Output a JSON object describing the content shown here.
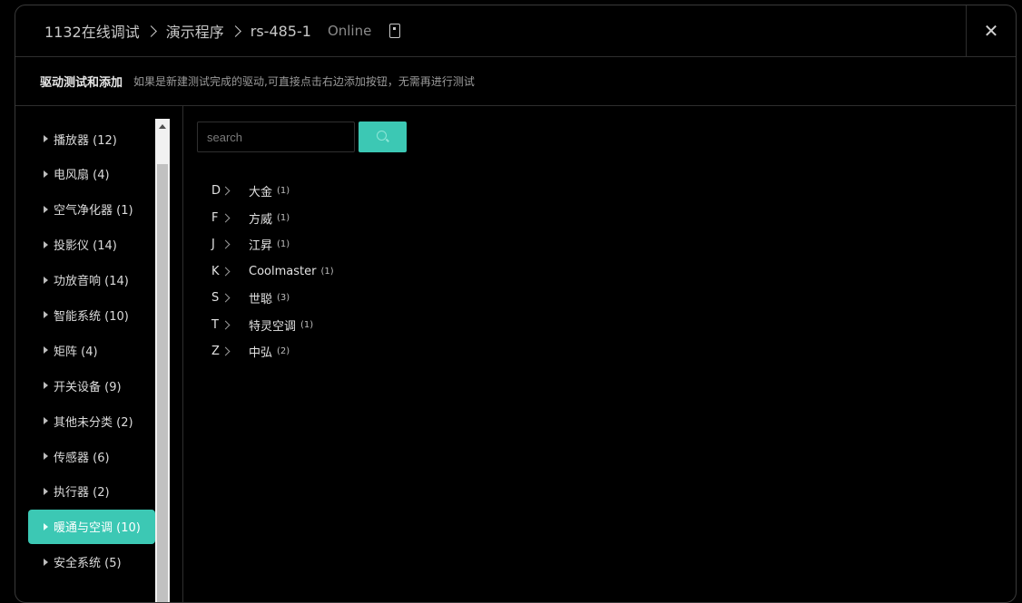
{
  "header": {
    "breadcrumbs": [
      "1132在线调试",
      "演示程序",
      "rs-485-1"
    ],
    "status": "Online",
    "device_icon": "mobile-device-icon",
    "close_label": "✕"
  },
  "subheader": {
    "title": "驱动测试和添加",
    "hint": "如果是新建测试完成的驱动,可直接点击右边添加按钮，无需再进行测试"
  },
  "sidebar": {
    "categories": [
      {
        "label": "播放器 (12)"
      },
      {
        "label": "电风扇 (4)"
      },
      {
        "label": "空气净化器 (1)"
      },
      {
        "label": "投影仪 (14)"
      },
      {
        "label": "功放音响 (14)"
      },
      {
        "label": "智能系统 (10)"
      },
      {
        "label": "矩阵 (4)"
      },
      {
        "label": "开关设备 (9)"
      },
      {
        "label": "其他未分类 (2)"
      },
      {
        "label": "传感器 (6)"
      },
      {
        "label": "执行器 (2)"
      },
      {
        "label": "暖通与空调 (10)"
      },
      {
        "label": "安全系统 (5)"
      }
    ],
    "active_index": 11
  },
  "search": {
    "placeholder": "search",
    "value": "",
    "button_icon": "search-icon"
  },
  "brands": [
    {
      "letter": "D",
      "name": "大金",
      "count": "(1)"
    },
    {
      "letter": "F",
      "name": "方威",
      "count": "(1)"
    },
    {
      "letter": "J",
      "name": "江昇",
      "count": "(1)"
    },
    {
      "letter": "K",
      "name": "Coolmaster",
      "count": "(1)"
    },
    {
      "letter": "S",
      "name": "世聪",
      "count": "(3)"
    },
    {
      "letter": "T",
      "name": "特灵空调",
      "count": "(1)"
    },
    {
      "letter": "Z",
      "name": "中弘",
      "count": "(2)"
    }
  ],
  "colors": {
    "accent": "#3cc8b4",
    "background": "#000000"
  }
}
